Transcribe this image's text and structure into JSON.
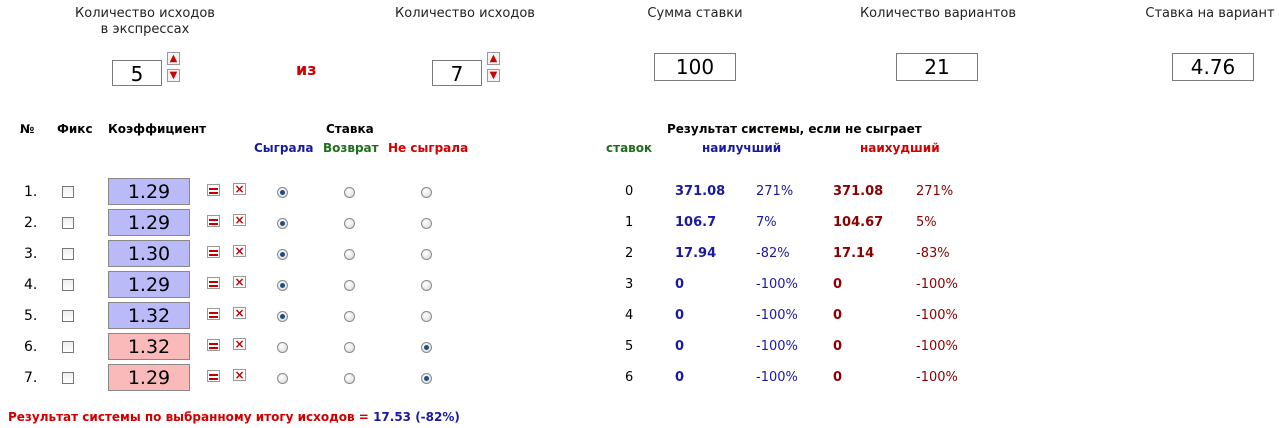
{
  "top": {
    "outcomes_in_express_label_line1": "Количество исходов",
    "outcomes_in_express_label_line2": "в экспрессах",
    "outcomes_in_express_value": "5",
    "iz_label": "из",
    "outcomes_label": "Количество исходов",
    "outcomes_value": "7",
    "stake_sum_label": "Сумма ставки",
    "stake_sum_value": "100",
    "variants_label": "Количество вариантов",
    "variants_value": "21",
    "stake_per_variant_label": "Ставка на вариант",
    "stake_per_variant_value": "4.76"
  },
  "table_headers": {
    "num": "№",
    "fix": "Фикс",
    "coef": "Коэффициент",
    "stake": "Ставка",
    "won": "Сыграла",
    "refund": "Возврат",
    "lost": "Не сыграла",
    "result": "Результат системы, если не сыграет",
    "bets": "ставок",
    "best": "наилучший",
    "worst": "наихудший"
  },
  "rows": [
    {
      "num": "1.",
      "coef": "1.29",
      "state": "won"
    },
    {
      "num": "2.",
      "coef": "1.29",
      "state": "won"
    },
    {
      "num": "3.",
      "coef": "1.30",
      "state": "won"
    },
    {
      "num": "4.",
      "coef": "1.29",
      "state": "won"
    },
    {
      "num": "5.",
      "coef": "1.32",
      "state": "won"
    },
    {
      "num": "6.",
      "coef": "1.32",
      "state": "lost"
    },
    {
      "num": "7.",
      "coef": "1.29",
      "state": "lost"
    }
  ],
  "results": [
    {
      "bets": "0",
      "best": "371.08",
      "best_pct": "271%",
      "worst": "371.08",
      "worst_pct": "271%"
    },
    {
      "bets": "1",
      "best": "106.7",
      "best_pct": "7%",
      "worst": "104.67",
      "worst_pct": "5%"
    },
    {
      "bets": "2",
      "best": "17.94",
      "best_pct": "-82%",
      "worst": "17.14",
      "worst_pct": "-83%"
    },
    {
      "bets": "3",
      "best": "0",
      "best_pct": "-100%",
      "worst": "0",
      "worst_pct": "-100%"
    },
    {
      "bets": "4",
      "best": "0",
      "best_pct": "-100%",
      "worst": "0",
      "worst_pct": "-100%"
    },
    {
      "bets": "5",
      "best": "0",
      "best_pct": "-100%",
      "worst": "0",
      "worst_pct": "-100%"
    },
    {
      "bets": "6",
      "best": "0",
      "best_pct": "-100%",
      "worst": "0",
      "worst_pct": "-100%"
    }
  ],
  "footer": {
    "label": "Результат системы по выбранному итогу исходов =",
    "value": "17.53 (-82%)"
  },
  "colors": {
    "accent_red": "#d00000",
    "accent_blue": "#1a1aa0",
    "won_bg": "#babaf8",
    "lost_bg": "#fbbaba"
  }
}
